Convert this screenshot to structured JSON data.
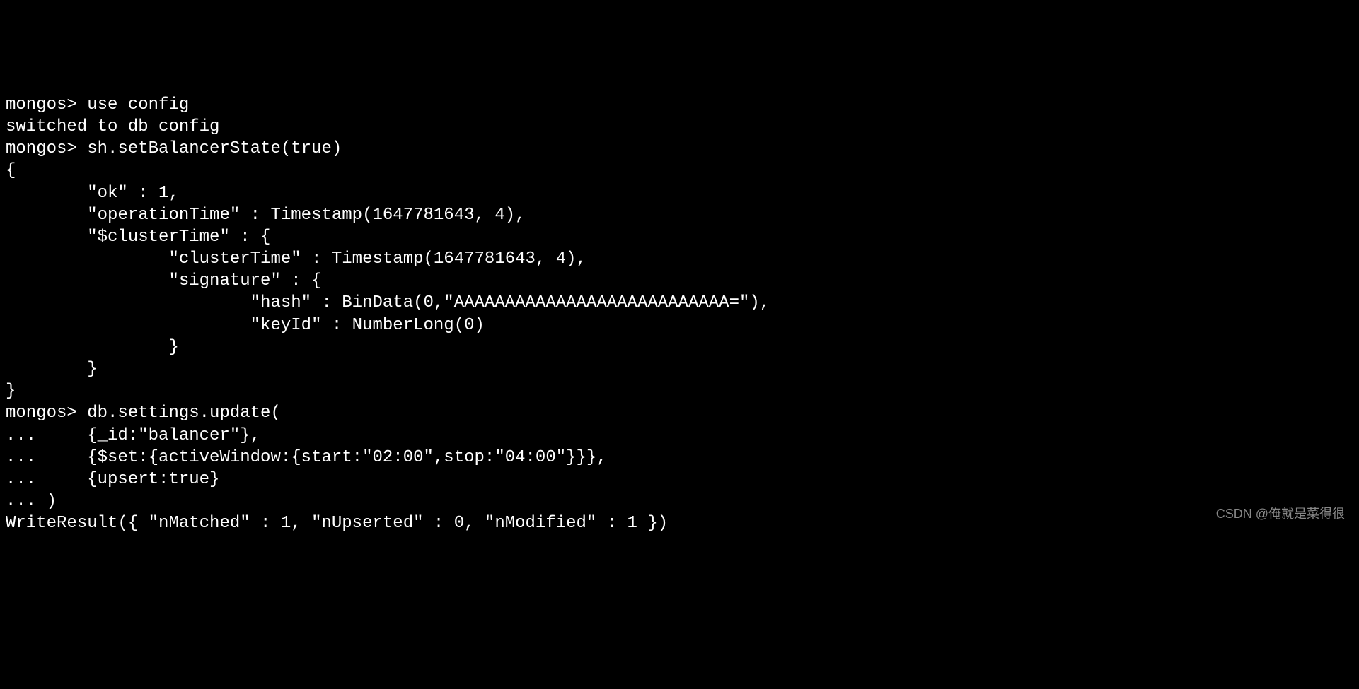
{
  "terminal": {
    "lines": [
      "mongos> use config",
      "switched to db config",
      "mongos> sh.setBalancerState(true)",
      "{",
      "        \"ok\" : 1,",
      "        \"operationTime\" : Timestamp(1647781643, 4),",
      "        \"$clusterTime\" : {",
      "                \"clusterTime\" : Timestamp(1647781643, 4),",
      "                \"signature\" : {",
      "                        \"hash\" : BinData(0,\"AAAAAAAAAAAAAAAAAAAAAAAAAAA=\"),",
      "                        \"keyId\" : NumberLong(0)",
      "                }",
      "        }",
      "}",
      "mongos> db.settings.update(",
      "...     {_id:\"balancer\"},",
      "...     {$set:{activeWindow:{start:\"02:00\",stop:\"04:00\"}}},",
      "...     {upsert:true}",
      "... )",
      "WriteResult({ \"nMatched\" : 1, \"nUpserted\" : 0, \"nModified\" : 1 })"
    ]
  },
  "watermark": "CSDN @俺就是菜得很"
}
